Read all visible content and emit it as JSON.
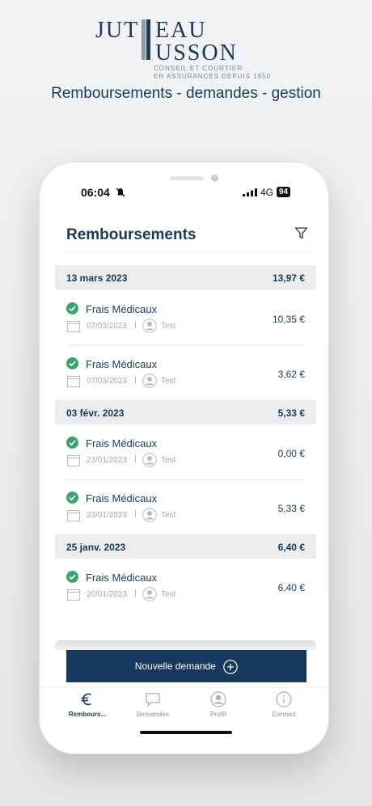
{
  "brand": {
    "sub_line1": "CONSEIL ET COURTIER",
    "sub_line2": "EN ASSURANCES DEPUIS 1950"
  },
  "tagline": "Remboursements - demandes - gestion",
  "status_bar": {
    "time": "06:04",
    "network": "4G",
    "battery": "94"
  },
  "screen": {
    "title": "Remboursements",
    "filter_icon": "filter-icon"
  },
  "groups": [
    {
      "date": "13 mars 2023",
      "total": "13,97 €",
      "items": [
        {
          "label": "Frais Médicaux",
          "date": "07/03/2023",
          "person": "Test",
          "amount": "10,35 €"
        },
        {
          "label": "Frais Médicaux",
          "date": "07/03/2023",
          "person": "Test",
          "amount": "3,62 €"
        }
      ]
    },
    {
      "date": "03 févr. 2023",
      "total": "5,33 €",
      "items": [
        {
          "label": "Frais Médicaux",
          "date": "23/01/2023",
          "person": "Test",
          "amount": "0,00 €"
        },
        {
          "label": "Frais Médicaux",
          "date": "23/01/2023",
          "person": "Test",
          "amount": "5,33 €"
        }
      ]
    },
    {
      "date": "25 janv. 2023",
      "total": "6,40 €",
      "items": [
        {
          "label": "Frais Médicaux",
          "date": "20/01/2023",
          "person": "Test",
          "amount": "6,40 €"
        }
      ]
    }
  ],
  "new_request_label": "Nouvelle demande",
  "tabs": [
    {
      "label": "Rembours...",
      "icon": "euro-icon",
      "active": true
    },
    {
      "label": "Demandes",
      "icon": "chat-icon",
      "active": false
    },
    {
      "label": "Profil",
      "icon": "user-icon",
      "active": false
    },
    {
      "label": "Contact",
      "icon": "info-icon",
      "active": false
    }
  ],
  "colors": {
    "primary": "#173a5c",
    "success": "#3aa56b",
    "header_bg": "#ededef"
  }
}
